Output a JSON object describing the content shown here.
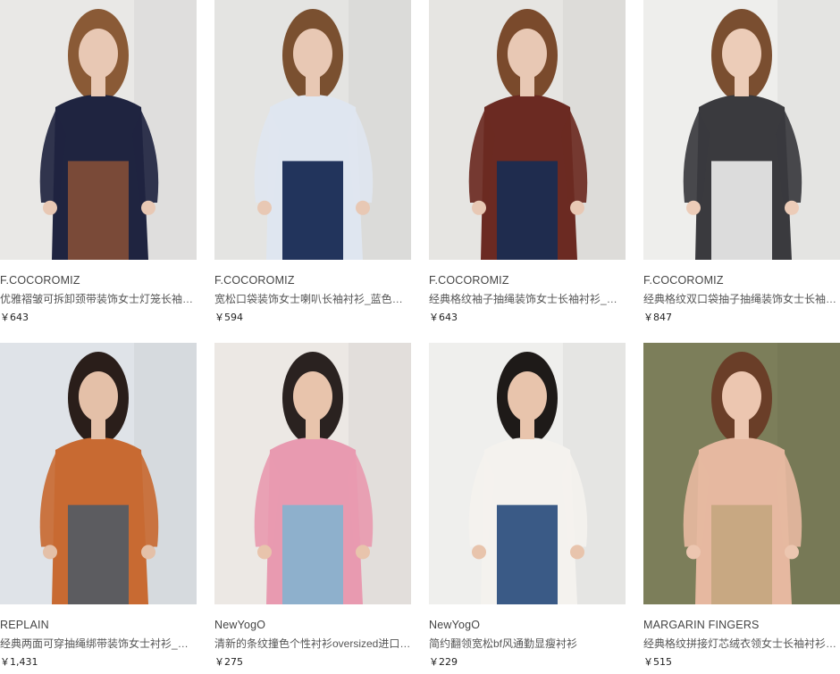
{
  "products": [
    {
      "brand": "F.COCOROMIZ",
      "title": "优雅褶皱可拆卸颈带装饰女士灯笼长袖…",
      "price": "￥643",
      "image": "model-navy-tie-neck-blouse",
      "bg": "#e9e8e6",
      "garment": "#1f2440",
      "accent": "#7a4a38",
      "skin": "#e8c8b4",
      "hair": "#8a5a36"
    },
    {
      "brand": "F.COCOROMIZ",
      "title": "宽松口袋装饰女士喇叭长袖衬衫_蓝色条…",
      "price": "￥594",
      "image": "model-blue-striped-shirt",
      "bg": "#e4e4e2",
      "garment": "#dfe6f0",
      "accent": "#22345c",
      "skin": "#e8c8b4",
      "hair": "#7a5030"
    },
    {
      "brand": "F.COCOROMIZ",
      "title": "经典格纹袖子抽绳装饰女士长袖衬衫_棕…",
      "price": "￥643",
      "image": "model-brown-plaid-shirt",
      "bg": "#e6e5e2",
      "garment": "#6b2a22",
      "accent": "#1f2c4e",
      "skin": "#e8c8b4",
      "hair": "#7a4a2c"
    },
    {
      "brand": "F.COCOROMIZ",
      "title": "经典格纹双口袋抽子抽绳装饰女士长袖…",
      "price": "￥847",
      "image": "model-black-white-plaid-shirt",
      "bg": "#eeeeec",
      "garment": "#3a3a3e",
      "accent": "#dcdcdc",
      "skin": "#ecccb8",
      "hair": "#7a4e30"
    },
    {
      "brand": "REPLAIN",
      "title": "经典两面可穿抽绳绑带装饰女士衬衫_红…",
      "price": "￥1,431",
      "image": "model-orange-blouse-back",
      "bg": "#dfe3e8",
      "garment": "#c86a32",
      "accent": "#5c5c60",
      "skin": "#e4c0a8",
      "hair": "#2a1e1a"
    },
    {
      "brand": "NewYogO",
      "title": "清新的条纹撞色个性衬衫oversized进口…",
      "price": "￥275",
      "image": "model-pink-striped-shirt",
      "bg": "#ece8e4",
      "garment": "#e89ab0",
      "accent": "#8eb0cc",
      "skin": "#e8c4ac",
      "hair": "#2a2220"
    },
    {
      "brand": "NewYogO",
      "title": "简约翻领宽松bf风通勤显瘦衬衫",
      "price": "￥229",
      "image": "model-white-satin-shirt",
      "bg": "#efefed",
      "garment": "#f4f2ee",
      "accent": "#3a5a86",
      "skin": "#e8c4ac",
      "hair": "#1e1a18"
    },
    {
      "brand": "MARGARIN FINGERS",
      "title": "经典格纹拼接灯芯绒衣领女士长袖衬衫…",
      "price": "￥515",
      "image": "model-rust-plaid-corduroy-collar",
      "bg": "#7c7e5a",
      "garment": "#e6b8a0",
      "accent": "#c8a882",
      "skin": "#ecc6b0",
      "hair": "#6a3e28"
    }
  ]
}
